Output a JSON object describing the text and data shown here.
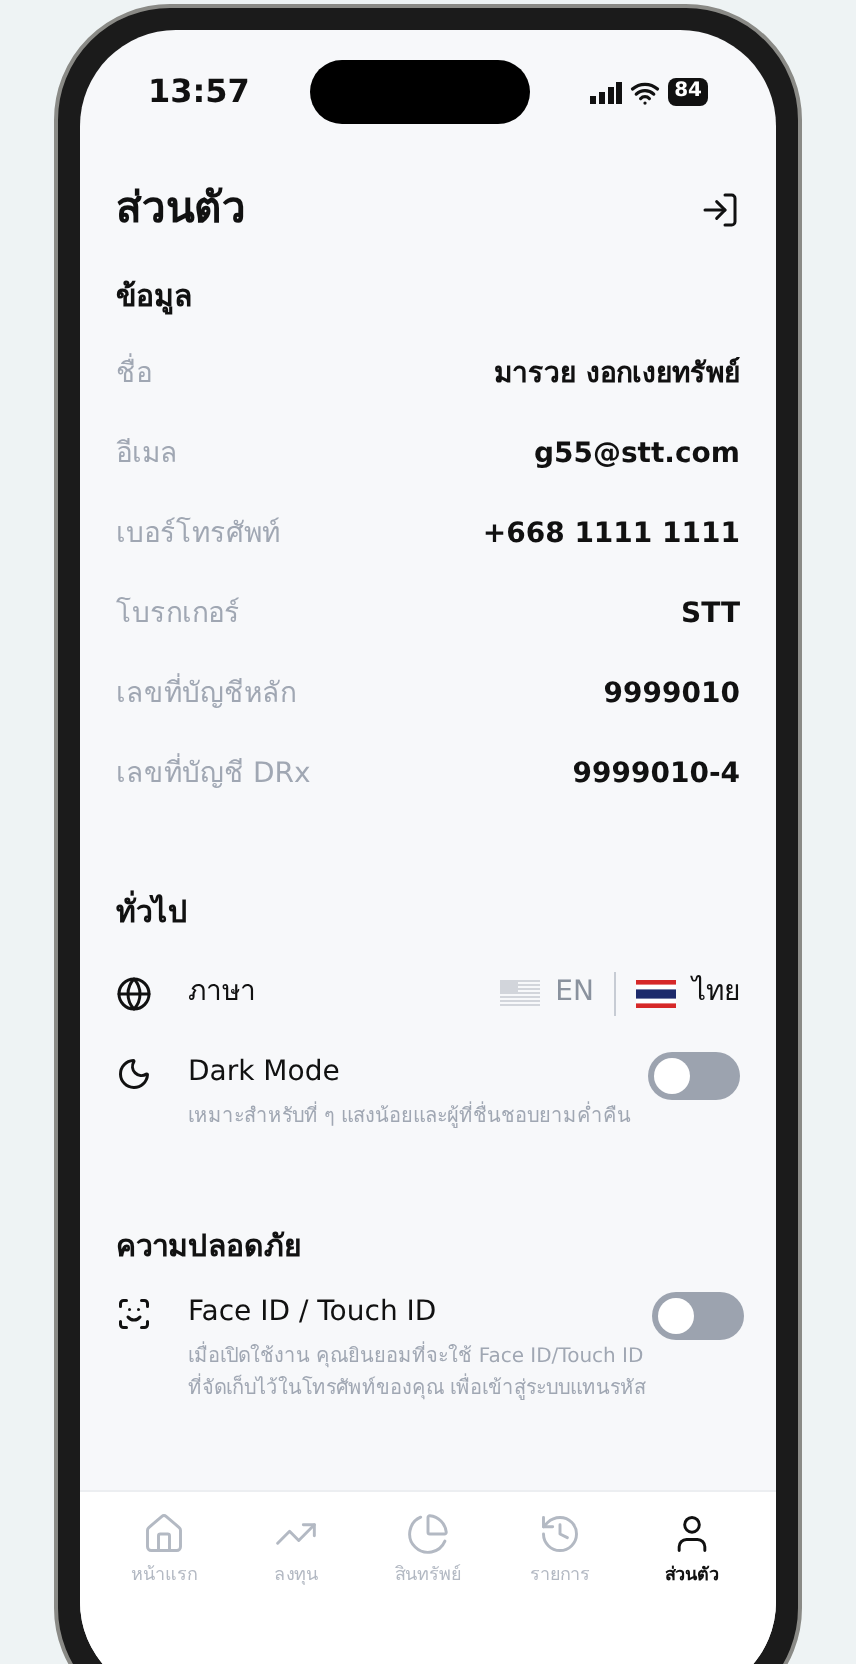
{
  "status_bar": {
    "time": "13:57",
    "battery": "84"
  },
  "header": {
    "title": "ส่วนตัว"
  },
  "info": {
    "title": "ข้อมูล",
    "rows": [
      {
        "label": "ชื่อ",
        "value": "มารวย งอกเงยทรัพย์"
      },
      {
        "label": "อีเมล",
        "value": "g55@stt.com"
      },
      {
        "label": "เบอร์โทรศัพท์",
        "value": "+668 1111 1111"
      },
      {
        "label": "โบรกเกอร์",
        "value": "STT"
      },
      {
        "label": "เลขที่บัญชีหลัก",
        "value": "9999010"
      },
      {
        "label": "เลขที่บัญชี DRx",
        "value": "9999010-4"
      }
    ]
  },
  "general": {
    "title": "ทั่วไป",
    "language": {
      "label": "ภาษา",
      "options": [
        {
          "kind": "us",
          "label": "EN",
          "selected": false
        },
        {
          "kind": "th",
          "label": "ไทย",
          "selected": true
        }
      ]
    },
    "dark_mode": {
      "label": "Dark Mode",
      "description": "เหมาะสำหรับที่ ๆ แสงน้อยและผู้ที่ชื่นชอบยามค่ำคืน",
      "on": false
    }
  },
  "security": {
    "title": "ความปลอดภัย",
    "face_id": {
      "label": "Face ID / Touch ID",
      "description": "เมื่อเปิดใช้งาน คุณยินยอมที่จะใช้ Face ID/Touch ID ที่จัดเก็บไว้ในโทรศัพท์ของคุณ เพื่อเข้าสู่ระบบแทนรหัส",
      "on": false
    }
  },
  "nav": [
    {
      "kind": "home",
      "label": "หน้าแรก",
      "selected": false
    },
    {
      "kind": "invest",
      "label": "ลงทุน",
      "selected": false
    },
    {
      "kind": "assets",
      "label": "สินทรัพย์",
      "selected": false
    },
    {
      "kind": "history",
      "label": "รายการ",
      "selected": false
    },
    {
      "kind": "profile",
      "label": "ส่วนตัว",
      "selected": true
    }
  ]
}
